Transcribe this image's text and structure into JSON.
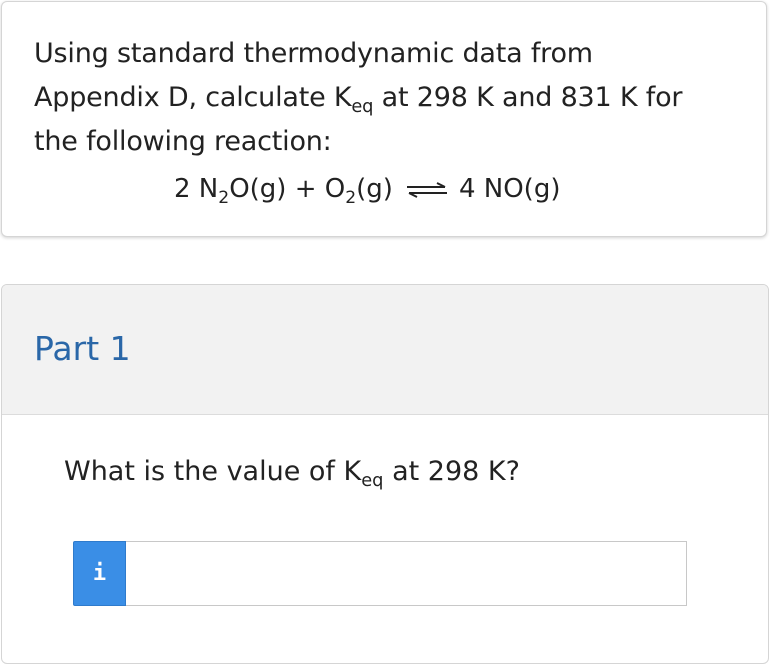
{
  "problem": {
    "line1": "Using standard thermodynamic data from",
    "line2_prefix": "Appendix D, calculate K",
    "line2_sub": "eq",
    "line2_suffix": " at 298 K and 831 K for",
    "line3": "the following reaction:",
    "equation": {
      "coef1": "2 N",
      "sub1": "2",
      "mid1": "O(g) + O",
      "sub2": "2",
      "mid2": "(g)",
      "product": "4 NO(g)"
    }
  },
  "part": {
    "title": "Part 1",
    "question_prefix": "What is the value of K",
    "question_sub": "eq",
    "question_suffix": " at 298 K?",
    "info_icon": "i",
    "answer_value": "",
    "answer_placeholder": ""
  },
  "colors": {
    "accent": "#3a8ee6",
    "part_title": "#2a67a8"
  }
}
